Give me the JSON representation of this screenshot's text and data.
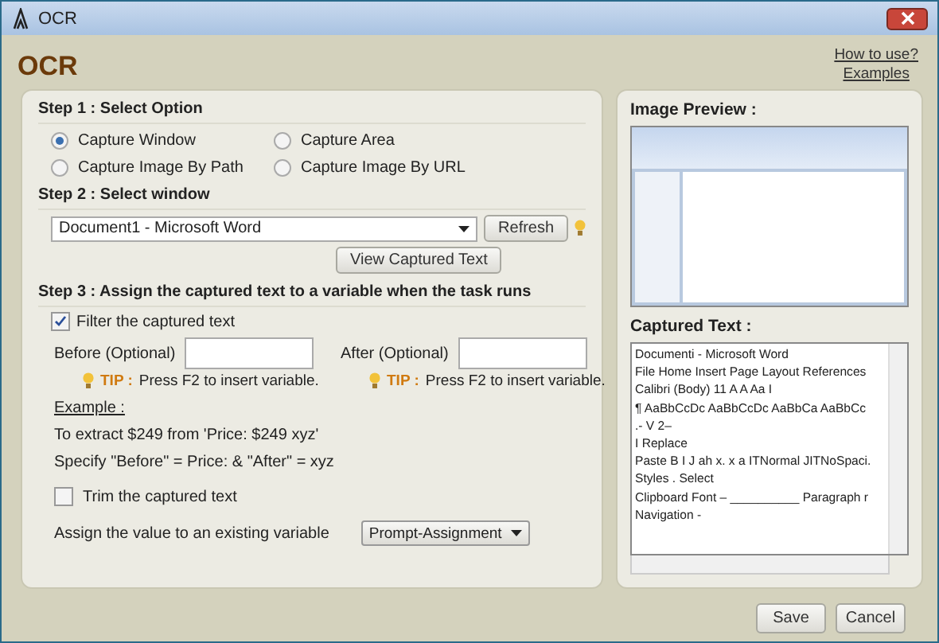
{
  "window": {
    "title": "OCR"
  },
  "header": {
    "title": "OCR",
    "links": [
      "How to use?",
      "Examples"
    ]
  },
  "step1": {
    "heading": "Step 1 : Select Option",
    "options": [
      {
        "label": "Capture Window",
        "selected": true
      },
      {
        "label": "Capture Area",
        "selected": false
      },
      {
        "label": "Capture Image By Path",
        "selected": false
      },
      {
        "label": "Capture Image By URL",
        "selected": false
      }
    ]
  },
  "step2": {
    "heading": "Step 2 : Select window",
    "window_select": "Document1 - Microsoft Word",
    "refresh_button": "Refresh",
    "view_button": "View Captured Text"
  },
  "step3": {
    "heading": "Step 3 : Assign the captured text to a variable when the task runs",
    "filter": {
      "label": "Filter the captured text",
      "checked": true
    },
    "fields": [
      {
        "label": "Before (Optional)",
        "tip_label": "TIP :",
        "tip": "Press F2 to insert variable."
      },
      {
        "label": "After (Optional)",
        "tip_label": "TIP :",
        "tip": "Press F2 to insert variable."
      }
    ],
    "example": {
      "heading": "Example :",
      "lines": [
        "To extract $249 from 'Price: $249 xyz'",
        "Specify \"Before\" = Price: & \"After\" = xyz"
      ]
    },
    "trim": {
      "label": "Trim the captured text",
      "checked": false
    },
    "assign": {
      "label": "Assign the value to an existing variable",
      "value": "Prompt-Assignment"
    }
  },
  "preview": {
    "heading": "Image Preview :",
    "captured_heading": "Captured Text :",
    "captured_lines": [
      "Documenti - Microsoft Word",
      "File Home Insert Page Layout References",
      "Calibri (Body) 11 A A Aa I",
      "¶ AaBbCcDc AaBbCcDc AaBbCa AaBbCc",
      ".- V 2–",
      "I Replace",
      "Paste B I J ah x. x a ITNormal JITNoSpaci.",
      "Styles . Select",
      "Clipboard Font – __________ Paragraph r",
      "Navigation -"
    ]
  },
  "buttons": [
    "Save",
    "Cancel"
  ]
}
